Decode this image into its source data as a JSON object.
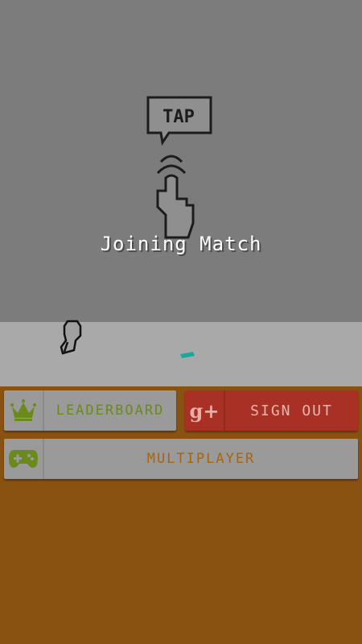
{
  "hint": {
    "bubble_text": "TAP"
  },
  "status": {
    "message": "Joining Match"
  },
  "buttons": {
    "leaderboard_label": "LEADERBOARD",
    "sign_out_label": "SIGN OUT",
    "google_plus_glyph": "g+",
    "multiplayer_label": "MULTIPLAYER"
  },
  "icons": {
    "leaderboard": "crown-icon",
    "sign_out": "google-plus-icon",
    "multiplayer": "gamepad-icon"
  },
  "colors": {
    "sky": "#7c7c7c",
    "ground": "#a9a9a9",
    "dirt": "#8a5210",
    "leaderboard_text": "#6a8a1c",
    "sign_out_bg": "#a83025",
    "multiplayer_text": "#a8650f",
    "target": "#1aa89a"
  }
}
